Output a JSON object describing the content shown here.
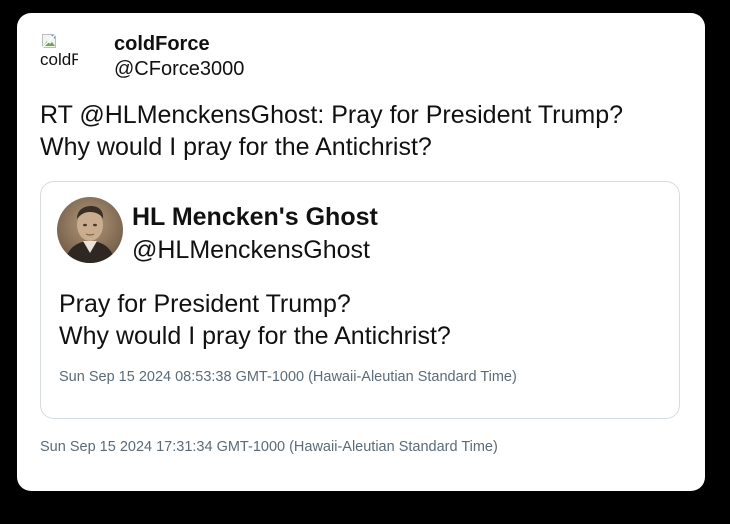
{
  "tweet": {
    "author": {
      "avatar_alt": "coldForce",
      "display_name": "coldForce",
      "handle": "@CForce3000"
    },
    "text_lines": [
      "RT @HLMenckensGhost: Pray for President Trump?",
      "Why would I pray for the Antichrist?"
    ],
    "timestamp": "Sun Sep 15 2024 17:31:34 GMT-1000 (Hawaii-Aleutian Standard Time)"
  },
  "quoted": {
    "author": {
      "display_name": "HL Mencken's Ghost",
      "handle": "@HLMenckensGhost"
    },
    "text_lines": [
      "Pray for President Trump?",
      "Why would I pray for the Antichrist?"
    ],
    "timestamp": "Sun Sep 15 2024 08:53:38 GMT-1000 (Hawaii-Aleutian Standard Time)"
  },
  "colors": {
    "page_background": "#000000",
    "card_background": "#ffffff",
    "text": "#111111",
    "muted_text": "#5b6b78",
    "quote_border": "#d6dbe0"
  },
  "icons": {
    "author_avatar": "broken-image-icon",
    "quoted_avatar": "portrait-photo"
  }
}
